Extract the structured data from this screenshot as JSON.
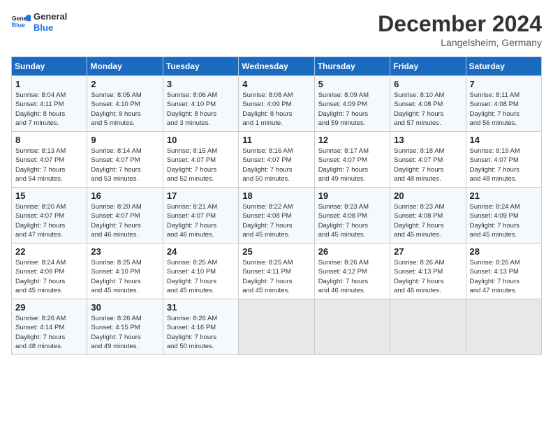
{
  "header": {
    "logo_line1": "General",
    "logo_line2": "Blue",
    "month": "December 2024",
    "location": "Langelsheim, Germany"
  },
  "days_of_week": [
    "Sunday",
    "Monday",
    "Tuesday",
    "Wednesday",
    "Thursday",
    "Friday",
    "Saturday"
  ],
  "weeks": [
    [
      {
        "day": "1",
        "info": "Sunrise: 8:04 AM\nSunset: 4:11 PM\nDaylight: 8 hours\nand 7 minutes."
      },
      {
        "day": "2",
        "info": "Sunrise: 8:05 AM\nSunset: 4:10 PM\nDaylight: 8 hours\nand 5 minutes."
      },
      {
        "day": "3",
        "info": "Sunrise: 8:06 AM\nSunset: 4:10 PM\nDaylight: 8 hours\nand 3 minutes."
      },
      {
        "day": "4",
        "info": "Sunrise: 8:08 AM\nSunset: 4:09 PM\nDaylight: 8 hours\nand 1 minute."
      },
      {
        "day": "5",
        "info": "Sunrise: 8:09 AM\nSunset: 4:09 PM\nDaylight: 7 hours\nand 59 minutes."
      },
      {
        "day": "6",
        "info": "Sunrise: 8:10 AM\nSunset: 4:08 PM\nDaylight: 7 hours\nand 57 minutes."
      },
      {
        "day": "7",
        "info": "Sunrise: 8:11 AM\nSunset: 4:08 PM\nDaylight: 7 hours\nand 56 minutes."
      }
    ],
    [
      {
        "day": "8",
        "info": "Sunrise: 8:13 AM\nSunset: 4:07 PM\nDaylight: 7 hours\nand 54 minutes."
      },
      {
        "day": "9",
        "info": "Sunrise: 8:14 AM\nSunset: 4:07 PM\nDaylight: 7 hours\nand 53 minutes."
      },
      {
        "day": "10",
        "info": "Sunrise: 8:15 AM\nSunset: 4:07 PM\nDaylight: 7 hours\nand 52 minutes."
      },
      {
        "day": "11",
        "info": "Sunrise: 8:16 AM\nSunset: 4:07 PM\nDaylight: 7 hours\nand 50 minutes."
      },
      {
        "day": "12",
        "info": "Sunrise: 8:17 AM\nSunset: 4:07 PM\nDaylight: 7 hours\nand 49 minutes."
      },
      {
        "day": "13",
        "info": "Sunrise: 8:18 AM\nSunset: 4:07 PM\nDaylight: 7 hours\nand 48 minutes."
      },
      {
        "day": "14",
        "info": "Sunrise: 8:19 AM\nSunset: 4:07 PM\nDaylight: 7 hours\nand 48 minutes."
      }
    ],
    [
      {
        "day": "15",
        "info": "Sunrise: 8:20 AM\nSunset: 4:07 PM\nDaylight: 7 hours\nand 47 minutes."
      },
      {
        "day": "16",
        "info": "Sunrise: 8:20 AM\nSunset: 4:07 PM\nDaylight: 7 hours\nand 46 minutes."
      },
      {
        "day": "17",
        "info": "Sunrise: 8:21 AM\nSunset: 4:07 PM\nDaylight: 7 hours\nand 46 minutes."
      },
      {
        "day": "18",
        "info": "Sunrise: 8:22 AM\nSunset: 4:08 PM\nDaylight: 7 hours\nand 45 minutes."
      },
      {
        "day": "19",
        "info": "Sunrise: 8:23 AM\nSunset: 4:08 PM\nDaylight: 7 hours\nand 45 minutes."
      },
      {
        "day": "20",
        "info": "Sunrise: 8:23 AM\nSunset: 4:08 PM\nDaylight: 7 hours\nand 45 minutes."
      },
      {
        "day": "21",
        "info": "Sunrise: 8:24 AM\nSunset: 4:09 PM\nDaylight: 7 hours\nand 45 minutes."
      }
    ],
    [
      {
        "day": "22",
        "info": "Sunrise: 8:24 AM\nSunset: 4:09 PM\nDaylight: 7 hours\nand 45 minutes."
      },
      {
        "day": "23",
        "info": "Sunrise: 8:25 AM\nSunset: 4:10 PM\nDaylight: 7 hours\nand 45 minutes."
      },
      {
        "day": "24",
        "info": "Sunrise: 8:25 AM\nSunset: 4:10 PM\nDaylight: 7 hours\nand 45 minutes."
      },
      {
        "day": "25",
        "info": "Sunrise: 8:25 AM\nSunset: 4:11 PM\nDaylight: 7 hours\nand 45 minutes."
      },
      {
        "day": "26",
        "info": "Sunrise: 8:26 AM\nSunset: 4:12 PM\nDaylight: 7 hours\nand 46 minutes."
      },
      {
        "day": "27",
        "info": "Sunrise: 8:26 AM\nSunset: 4:13 PM\nDaylight: 7 hours\nand 46 minutes."
      },
      {
        "day": "28",
        "info": "Sunrise: 8:26 AM\nSunset: 4:13 PM\nDaylight: 7 hours\nand 47 minutes."
      }
    ],
    [
      {
        "day": "29",
        "info": "Sunrise: 8:26 AM\nSunset: 4:14 PM\nDaylight: 7 hours\nand 48 minutes."
      },
      {
        "day": "30",
        "info": "Sunrise: 8:26 AM\nSunset: 4:15 PM\nDaylight: 7 hours\nand 49 minutes."
      },
      {
        "day": "31",
        "info": "Sunrise: 8:26 AM\nSunset: 4:16 PM\nDaylight: 7 hours\nand 50 minutes."
      },
      null,
      null,
      null,
      null
    ]
  ]
}
